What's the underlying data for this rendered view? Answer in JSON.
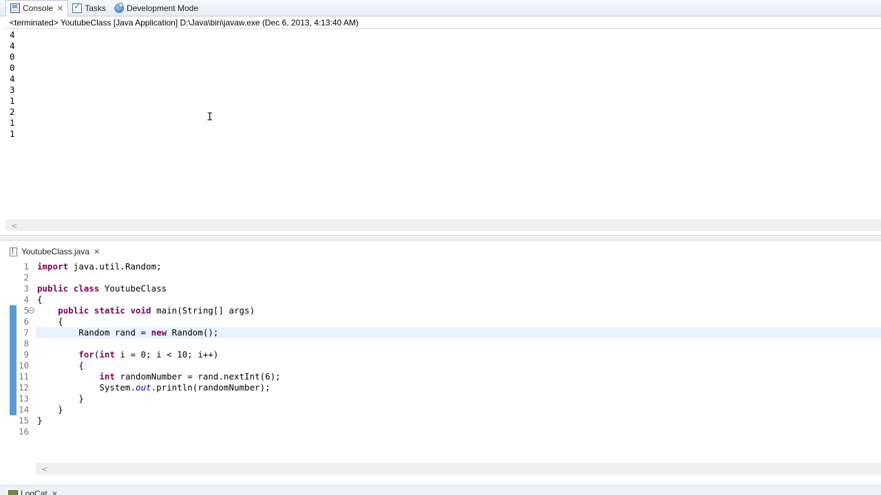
{
  "console_view": {
    "tabs": [
      {
        "label": "Console",
        "icon": "console-icon",
        "active": true,
        "closable": true
      },
      {
        "label": "Tasks",
        "icon": "tasks-icon",
        "active": false,
        "closable": false
      },
      {
        "label": "Development Mode",
        "icon": "development-mode-icon",
        "active": false,
        "closable": false
      }
    ],
    "status": "<terminated> YoutubeClass [Java Application] D:\\Java\\bin\\javaw.exe (Dec 6, 2013, 4:13:40 AM)",
    "output_lines": [
      "4",
      "4",
      "0",
      "0",
      "4",
      "3",
      "1",
      "2",
      "1",
      "1"
    ],
    "scroll_left_arrow": "<"
  },
  "editor": {
    "tab_label": "YoutubeClass.java",
    "line_numbers": [
      "1",
      "2",
      "3",
      "4",
      "5",
      "6",
      "7",
      "8",
      "9",
      "10",
      "11",
      "12",
      "13",
      "14",
      "15",
      "16"
    ],
    "current_line": 7,
    "changed_lines": [
      5,
      6,
      7,
      8,
      9,
      10,
      11,
      12,
      13,
      14
    ],
    "folding_marker_line": 5,
    "scroll_left_arrow": "<"
  },
  "bottom_view": {
    "tab_label": "LogCat"
  },
  "colors": {
    "keyword": "#7f0055",
    "static_field": "#0000c0",
    "current_line_highlight": "#e8f2fe",
    "quick_diff_marker": "#5b9bd5"
  }
}
